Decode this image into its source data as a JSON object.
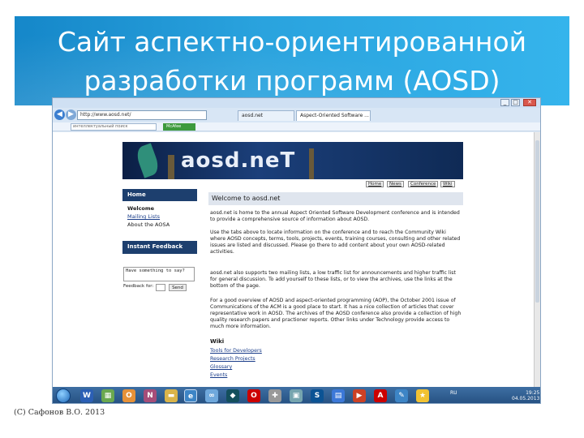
{
  "slide": {
    "title_line1": "Сайт аспектно-ориентированной",
    "title_line2": "разработки программ (AOSD)",
    "credit": "(C)  Сафонов В.О. 2013",
    "header_color": "#1e95d6"
  },
  "browser": {
    "address": "http://www.aosd.net/",
    "tab_inactive": "aosd.net",
    "tab_active": "Aspect-Oriented Software ...",
    "search_placeholder": "интеллектуальный поиск",
    "addon_label": "McAfee"
  },
  "site": {
    "logo": "aosd.neT",
    "top_tabs": [
      "Home",
      "News",
      "Conference",
      "Wiki"
    ],
    "sidebar": {
      "home_header": "Home",
      "links": [
        "Welcome",
        "Mailing Lists",
        "About the AOSA"
      ],
      "feedback_header": "Instant Feedback",
      "feedback_text": "Have something to say?",
      "feedback_for": "Feedback for:",
      "send_label": "Send"
    },
    "welcome_title": "Welcome to aosd.net",
    "paragraphs": {
      "p1": "aosd.net is home to the annual Aspect Oriented Software Development conference and is intended to provide a comprehensive source of information about AOSD.",
      "p2": "Use the tabs above to locate information on the conference and to reach the Community Wiki where AOSD concepts, terms, tools, projects, events, training courses, consulting and other related issues are listed and discussed. Please go there to add content about your own AOSD-related activities.",
      "p3": "aosd.net also supports two mailing lists, a low traffic list for announcements and higher traffic list for general discussion. To add yourself to these lists, or to view the archives, use the links at the bottom of the page.",
      "p4": "For a good overview of AOSD and aspect-oriented programming (AOP), the October 2001 issue of Communications of the ACM is a good place to start. It has a nice collection of articles that cover representative work in AOSD. The archives of the AOSD conference also provide a collection of high quality research papers and practioner reports. Other links under Technology provide access to much more information."
    },
    "wiki_header": "Wiki",
    "wiki_links": [
      "Tools for Developers",
      "Research Projects",
      "Glossary",
      "Events"
    ]
  },
  "taskbar": {
    "lang": "RU",
    "time": "19:25",
    "date": "04.05.2013"
  }
}
